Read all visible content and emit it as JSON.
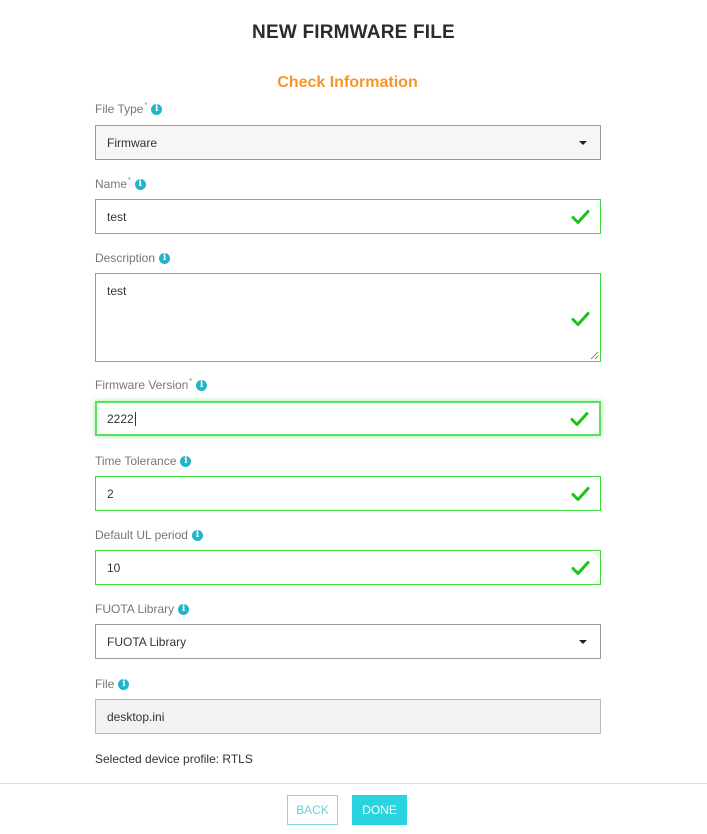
{
  "header": {
    "title": "NEW FIRMWARE FILE",
    "subtitle": "Check Information"
  },
  "form": {
    "file_type": {
      "label": "File Type",
      "required": "*",
      "value": "Firmware"
    },
    "name": {
      "label": "Name",
      "required": "*",
      "value": "test"
    },
    "description": {
      "label": "Description",
      "value": "test"
    },
    "firmware_version": {
      "label": "Firmware Version",
      "required": "*",
      "value": "2222"
    },
    "time_tolerance": {
      "label": "Time Tolerance",
      "value": "2"
    },
    "default_ul_period": {
      "label": "Default UL period",
      "value": "10"
    },
    "fuota_library": {
      "label": "FUOTA Library",
      "value": "FUOTA Library"
    },
    "file": {
      "label": "File",
      "value": "desktop.ini"
    },
    "profile_note": "Selected device profile: RTLS"
  },
  "footer": {
    "back_label": "BACK",
    "done_label": "DONE"
  },
  "icons": {
    "info": "info-icon",
    "check": "check-icon",
    "dropdown": "caret-down-icon"
  },
  "colors": {
    "accent_orange": "#f5962b",
    "valid_green": "#3ddc3d",
    "info_teal": "#1fb6c9",
    "button_teal": "#29d3df"
  }
}
